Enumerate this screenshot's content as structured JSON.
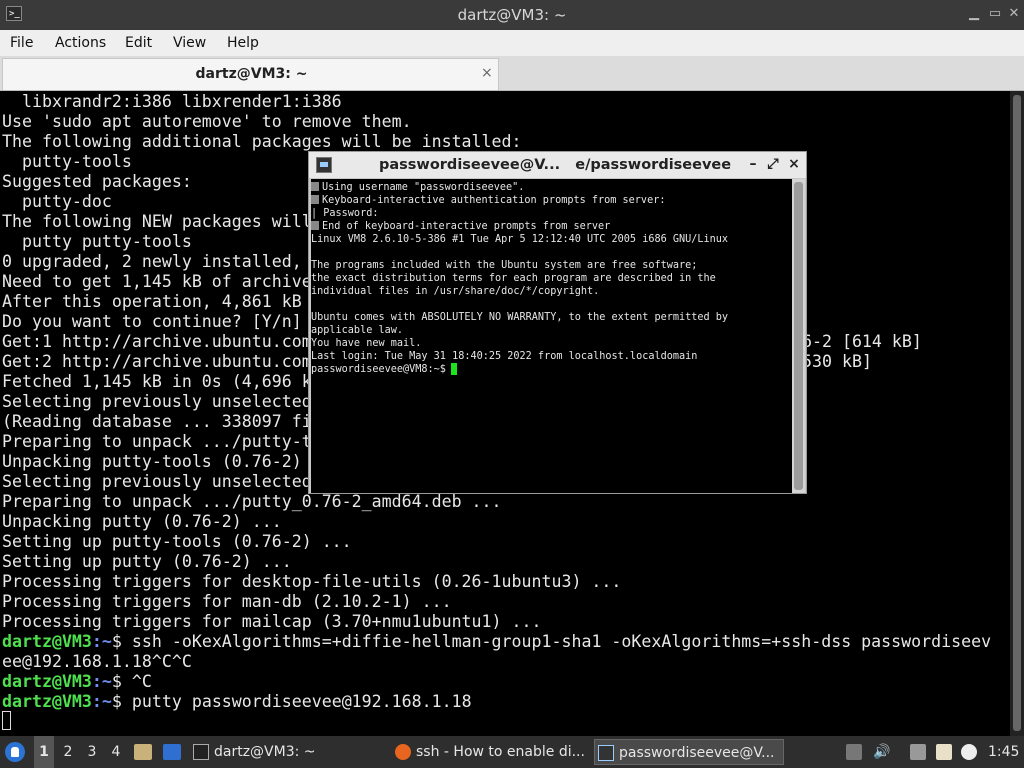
{
  "window": {
    "title": "dartz@VM3: ~",
    "controls": [
      "minimize",
      "maximize",
      "close"
    ]
  },
  "menu": [
    "File",
    "Actions",
    "Edit",
    "View",
    "Help"
  ],
  "tab": {
    "label": "dartz@VM3: ~",
    "close": "×"
  },
  "terminal": {
    "lines": [
      "  libxrandr2:i386 libxrender1:i386",
      "Use 'sudo apt autoremove' to remove them.",
      "The following additional packages will be installed:",
      "  putty-tools",
      "Suggested packages:",
      "  putty-doc",
      "The following NEW packages will",
      "  putty putty-tools",
      "0 upgraded, 2 newly installed,",
      "Need to get 1,145 kB of archive",
      "After this operation, 4,861 kB",
      "Do you want to continue? [Y/n]",
      "Get:1 http://archive.ubuntu.com",
      "Get:2 http://archive.ubuntu.com",
      "Fetched 1,145 kB in 0s (4,696 k",
      "Selecting previously unselected",
      "(Reading database ... 338097 fi",
      "Preparing to unpack .../putty-t",
      "Unpacking putty-tools (0.76-2)",
      "Selecting previously unselected",
      "Preparing to unpack .../putty_0.76-2_amd64.deb ...",
      "Unpacking putty (0.76-2) ...",
      "Setting up putty-tools (0.76-2) ...",
      "Setting up putty (0.76-2) ...",
      "Processing triggers for desktop-file-utils (0.26-1ubuntu3) ...",
      "Processing triggers for man-db (2.10.2-1) ...",
      "Processing triggers for mailcap (3.70+nmu1ubuntu1) ..."
    ],
    "right_fragments": [
      "76-2 [614 kB]",
      "530 kB]"
    ],
    "prompt_user": "dartz@VM3",
    "prompt_path": ":~",
    "prompt_symbol": "$",
    "prompts": [
      " ssh -oKexAlgorithms=+diffie-hellman-group1-sha1 -oKexAlgorithms=+ssh-dss passwordiseev",
      " ^C",
      " putty passwordiseevee@192.168.1.18"
    ],
    "wrap_line": "ee@192.168.1.18^C^C"
  },
  "putty": {
    "title_left": "passwordiseevee@V...",
    "title_right": "e/passwordiseevee",
    "buttons": [
      "–",
      "⤢",
      "×"
    ],
    "lines": [
      "Using username \"passwordiseevee\".",
      "Keyboard-interactive authentication prompts from server:",
      "| Password:",
      "End of keyboard-interactive prompts from server",
      "Linux VM8 2.6.10-5-386 #1 Tue Apr 5 12:12:40 UTC 2005 i686 GNU/Linux",
      "",
      "The programs included with the Ubuntu system are free software;",
      "the exact distribution terms for each program are described in the",
      "individual files in /usr/share/doc/*/copyright.",
      "",
      "Ubuntu comes with ABSOLUTELY NO WARRANTY, to the extent permitted by",
      "applicable law.",
      "You have new mail.",
      "Last login: Tue May 31 18:40:25 2022 from localhost.localdomain",
      "passwordiseevee@VM8:~$"
    ]
  },
  "taskbar": {
    "workspaces": [
      "1",
      "2",
      "3",
      "4"
    ],
    "tasks": [
      {
        "label": "dartz@VM3: ~",
        "icon": "terminal-icon"
      },
      {
        "label": "ssh - How to enable di...",
        "icon": "firefox-icon"
      },
      {
        "label": "passwordiseevee@V...",
        "icon": "putty-icon"
      }
    ],
    "clock": "1:45"
  }
}
